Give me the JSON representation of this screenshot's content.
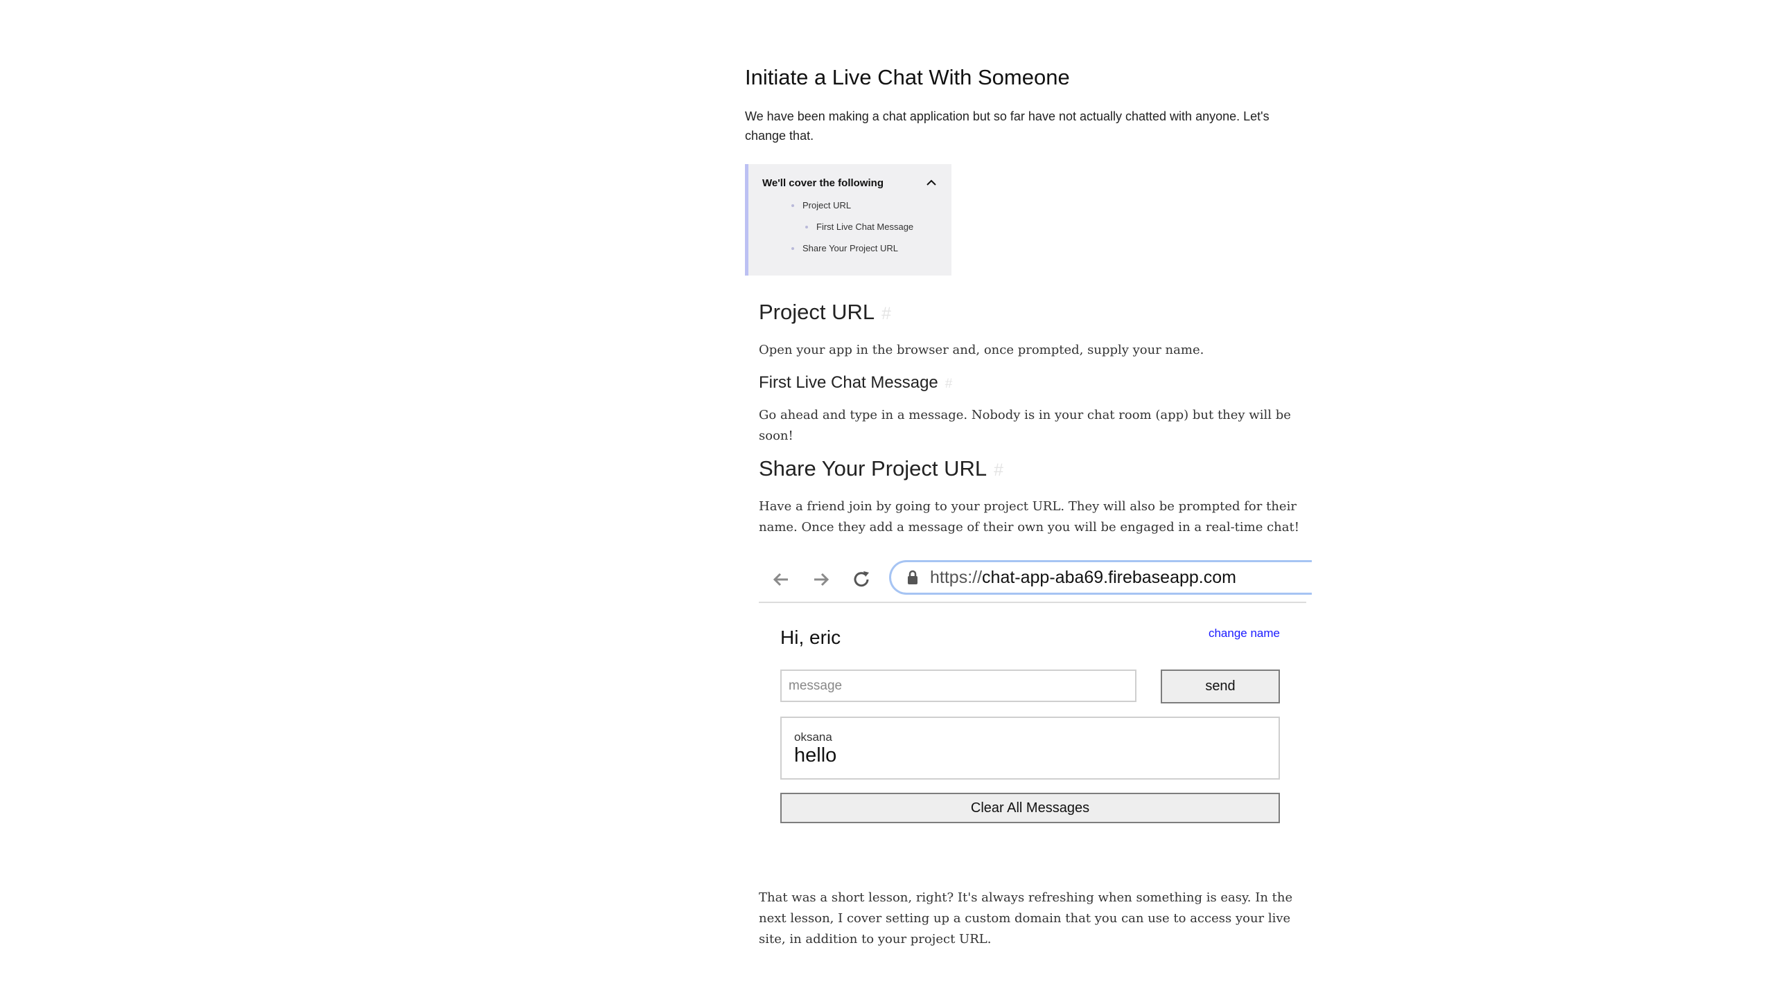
{
  "lesson": {
    "title": "Initiate a Live Chat With Someone",
    "intro": "We have been making a chat application but so far have not actually chatted with anyone. Let's change that."
  },
  "toc": {
    "title": "We'll cover the following",
    "toggle_icon": "chevron-up-icon",
    "items": [
      {
        "label": "Project URL",
        "level": 1
      },
      {
        "label": "First Live Chat Message",
        "level": 2
      },
      {
        "label": "Share Your Project URL",
        "level": 1
      }
    ]
  },
  "sections": {
    "project_url": {
      "heading": "Project URL",
      "anchor": "#",
      "text": "Open your app in the browser and, once prompted, supply your name."
    },
    "first_message": {
      "heading": "First Live Chat Message",
      "anchor": "#",
      "text": "Go ahead and type in a message. Nobody is in your chat room (app) but they will be soon!"
    },
    "share_url": {
      "heading": "Share Your Project URL",
      "anchor": "#",
      "text": "Have a friend join by going to your project URL. They will also be prompted for their name. Once they add a message of their own you will be engaged in a real-time chat!"
    }
  },
  "screenshot": {
    "browser": {
      "url_scheme": "https://",
      "url_host": "chat-app-aba69.firebaseapp.com",
      "back_icon": "arrow-left-icon",
      "forward_icon": "arrow-right-icon",
      "reload_icon": "reload-icon",
      "lock_icon": "lock-icon"
    },
    "app": {
      "greeting": "Hi, eric",
      "change_name_label": "change name",
      "message_placeholder": "message",
      "send_label": "send",
      "messages": [
        {
          "author": "oksana",
          "text": "hello"
        }
      ],
      "clear_label": "Clear All Messages"
    }
  },
  "closing": {
    "text": "That was a short lesson, right? It's always refreshing when something is easy. In the next lesson, I cover setting up a custom domain that you can use to access your live site, in addition to your project URL."
  },
  "colors": {
    "toc_background": "#f0f0f2",
    "toc_accent": "#bcc0f3",
    "link": "#1a1aff",
    "url_focus_border": "#a6c4f3"
  }
}
